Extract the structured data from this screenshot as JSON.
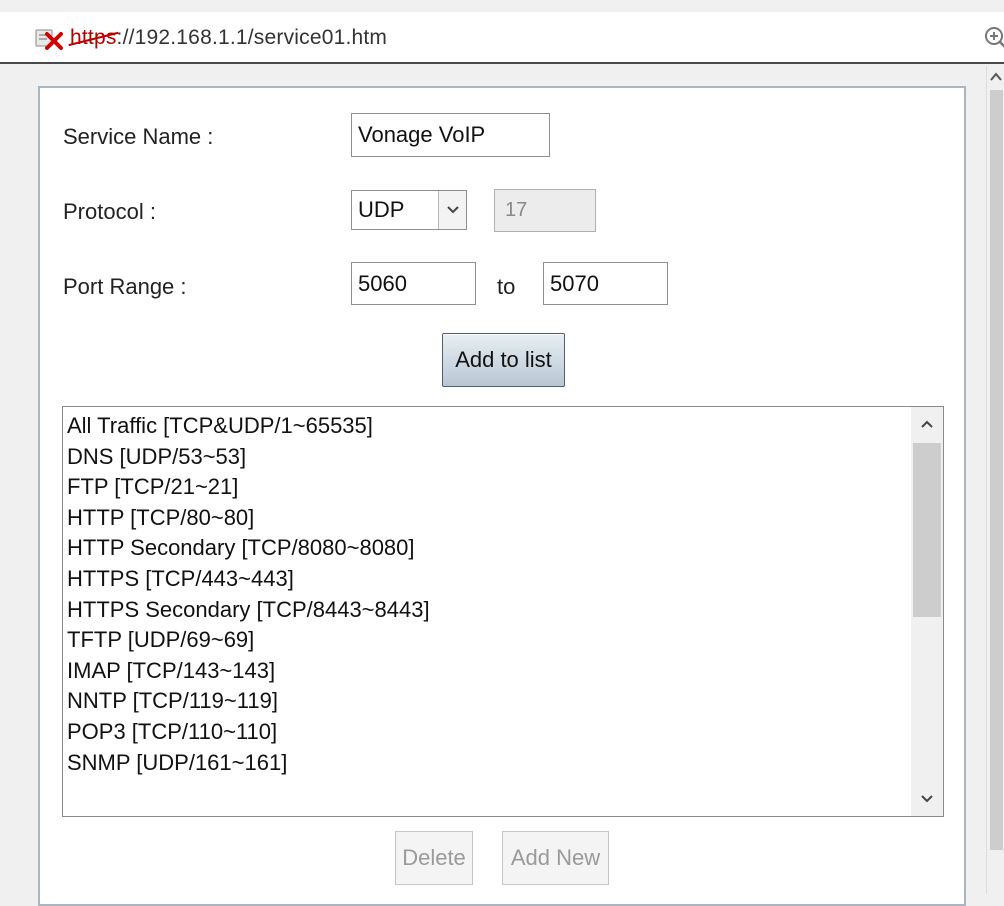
{
  "browser": {
    "url_protocol": "https",
    "url_rest": "://192.168.1.1/service01.htm"
  },
  "form": {
    "service_name_label": "Service Name :",
    "service_name_value": "Vonage VoIP",
    "protocol_label": "Protocol :",
    "protocol_value": "UDP",
    "protocol_number": "17",
    "port_range_label": "Port Range :",
    "port_start": "5060",
    "port_to_label": "to",
    "port_end": "5070",
    "add_to_list_label": "Add to list"
  },
  "service_list": {
    "items": [
      "All Traffic [TCP&UDP/1~65535]",
      "DNS [UDP/53~53]",
      "FTP [TCP/21~21]",
      "HTTP [TCP/80~80]",
      "HTTP Secondary [TCP/8080~8080]",
      "HTTPS [TCP/443~443]",
      "HTTPS Secondary [TCP/8443~8443]",
      "TFTP [UDP/69~69]",
      "IMAP [TCP/143~143]",
      "NNTP [TCP/119~119]",
      "POP3 [TCP/110~110]",
      "SNMP [UDP/161~161]"
    ]
  },
  "actions": {
    "delete_label": "Delete",
    "add_new_label": "Add New"
  },
  "icons": {
    "certificate_error": "certificate-error-icon",
    "zoom": "zoom-icon",
    "scroll_up": "chevron-up-icon",
    "scroll_down": "chevron-down-icon",
    "dropdown": "chevron-down-icon"
  },
  "colors": {
    "cert_error": "#c00000",
    "panel_border": "#a9b6c0",
    "primary_button": "#b8c7d4"
  }
}
